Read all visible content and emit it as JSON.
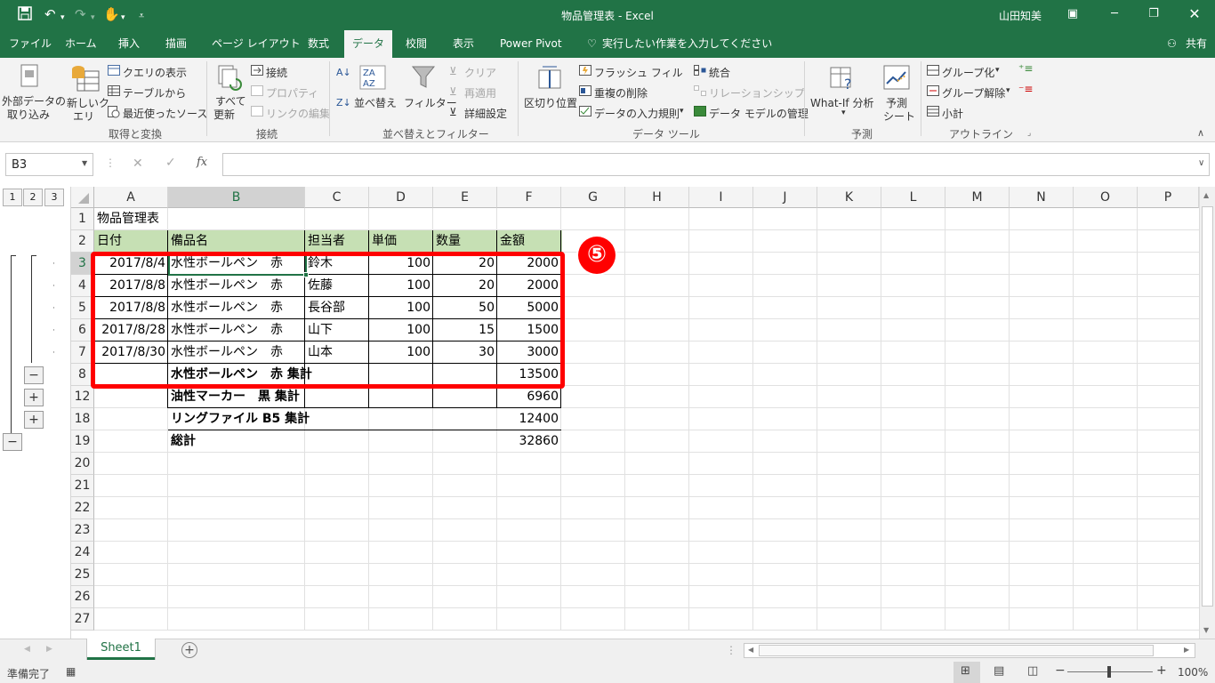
{
  "window": {
    "title": "物品管理表 - Excel",
    "user": "山田知美",
    "share_label": "共有"
  },
  "tabs": [
    "ファイル",
    "ホーム",
    "挿入",
    "描画",
    "ページ レイアウト",
    "数式",
    "データ",
    "校閲",
    "表示",
    "Power Pivot"
  ],
  "active_tab": "データ",
  "tell_me": "実行したい作業を入力してください",
  "ribbon": {
    "get_transform": {
      "label": "取得と変換",
      "external_data": [
        "外部データの",
        "取り込み"
      ],
      "new_query": [
        "新しいク",
        "エリ"
      ],
      "show_queries": "クエリの表示",
      "from_table": "テーブルから",
      "recent_sources": "最近使ったソース"
    },
    "connections": {
      "label": "接続",
      "refresh_all": [
        "すべて",
        "更新"
      ],
      "connections": "接続",
      "properties": "プロパティ",
      "edit_links": "リンクの編集"
    },
    "sort_filter": {
      "label": "並べ替えとフィルター",
      "sort": "並べ替え",
      "filter": "フィルター",
      "clear": "クリア",
      "reapply": "再適用",
      "advanced": "詳細設定"
    },
    "data_tools": {
      "label": "データ ツール",
      "text_to_columns": "区切り位置",
      "flash_fill": "フラッシュ フィル",
      "remove_duplicates": "重複の削除",
      "data_validation": "データの入力規則",
      "consolidate": "統合",
      "relationships": "リレーションシップ",
      "data_model": "データ モデルの管理"
    },
    "forecast": {
      "label": "予測",
      "what_if": "What-If 分析",
      "forecast_sheet": [
        "予測",
        "シート"
      ]
    },
    "outline": {
      "label": "アウトライン",
      "group": "グループ化",
      "ungroup": "グループ解除",
      "subtotal": "小計"
    }
  },
  "formula_bar": {
    "name_box": "B3",
    "formula": ""
  },
  "columns": [
    "A",
    "B",
    "C",
    "D",
    "E",
    "F",
    "G",
    "H",
    "I",
    "J",
    "K",
    "L",
    "M",
    "N",
    "O",
    "P"
  ],
  "rows": [
    "1",
    "2",
    "3",
    "4",
    "5",
    "6",
    "7",
    "8",
    "12",
    "18",
    "19",
    "20",
    "21",
    "22",
    "23",
    "24",
    "25",
    "26",
    "27"
  ],
  "outline_levels": [
    "1",
    "2",
    "3"
  ],
  "sheet": {
    "title_cell": "物品管理表",
    "headers": [
      "日付",
      "備品名",
      "担当者",
      "単価",
      "数量",
      "金額"
    ],
    "data_rows": [
      {
        "date": "2017/8/4",
        "item": "水性ボールペン　赤",
        "person": "鈴木",
        "price": "100",
        "qty": "20",
        "amount": "2000"
      },
      {
        "date": "2017/8/8",
        "item": "水性ボールペン　赤",
        "person": "佐藤",
        "price": "100",
        "qty": "20",
        "amount": "2000"
      },
      {
        "date": "2017/8/8",
        "item": "水性ボールペン　赤",
        "person": "長谷部",
        "price": "100",
        "qty": "50",
        "amount": "5000"
      },
      {
        "date": "2017/8/28",
        "item": "水性ボールペン　赤",
        "person": "山下",
        "price": "100",
        "qty": "15",
        "amount": "1500"
      },
      {
        "date": "2017/8/30",
        "item": "水性ボールペン　赤",
        "person": "山本",
        "price": "100",
        "qty": "30",
        "amount": "3000"
      }
    ],
    "subtotals": [
      {
        "label": "水性ボールペン　赤 集計",
        "amount": "13500"
      },
      {
        "label": "油性マーカー　黒 集計",
        "amount": "6960"
      },
      {
        "label": "リングファイル B5 集計",
        "amount": "12400"
      },
      {
        "label": "総計",
        "amount": "32860"
      }
    ]
  },
  "annotation": "⑤",
  "sheet_tab": "Sheet1",
  "status": {
    "ready": "準備完了",
    "zoom": "100%"
  },
  "colors": {
    "excel_green": "#217346",
    "header_fill": "#c6e0b4",
    "highlight_red": "#ff0000"
  }
}
